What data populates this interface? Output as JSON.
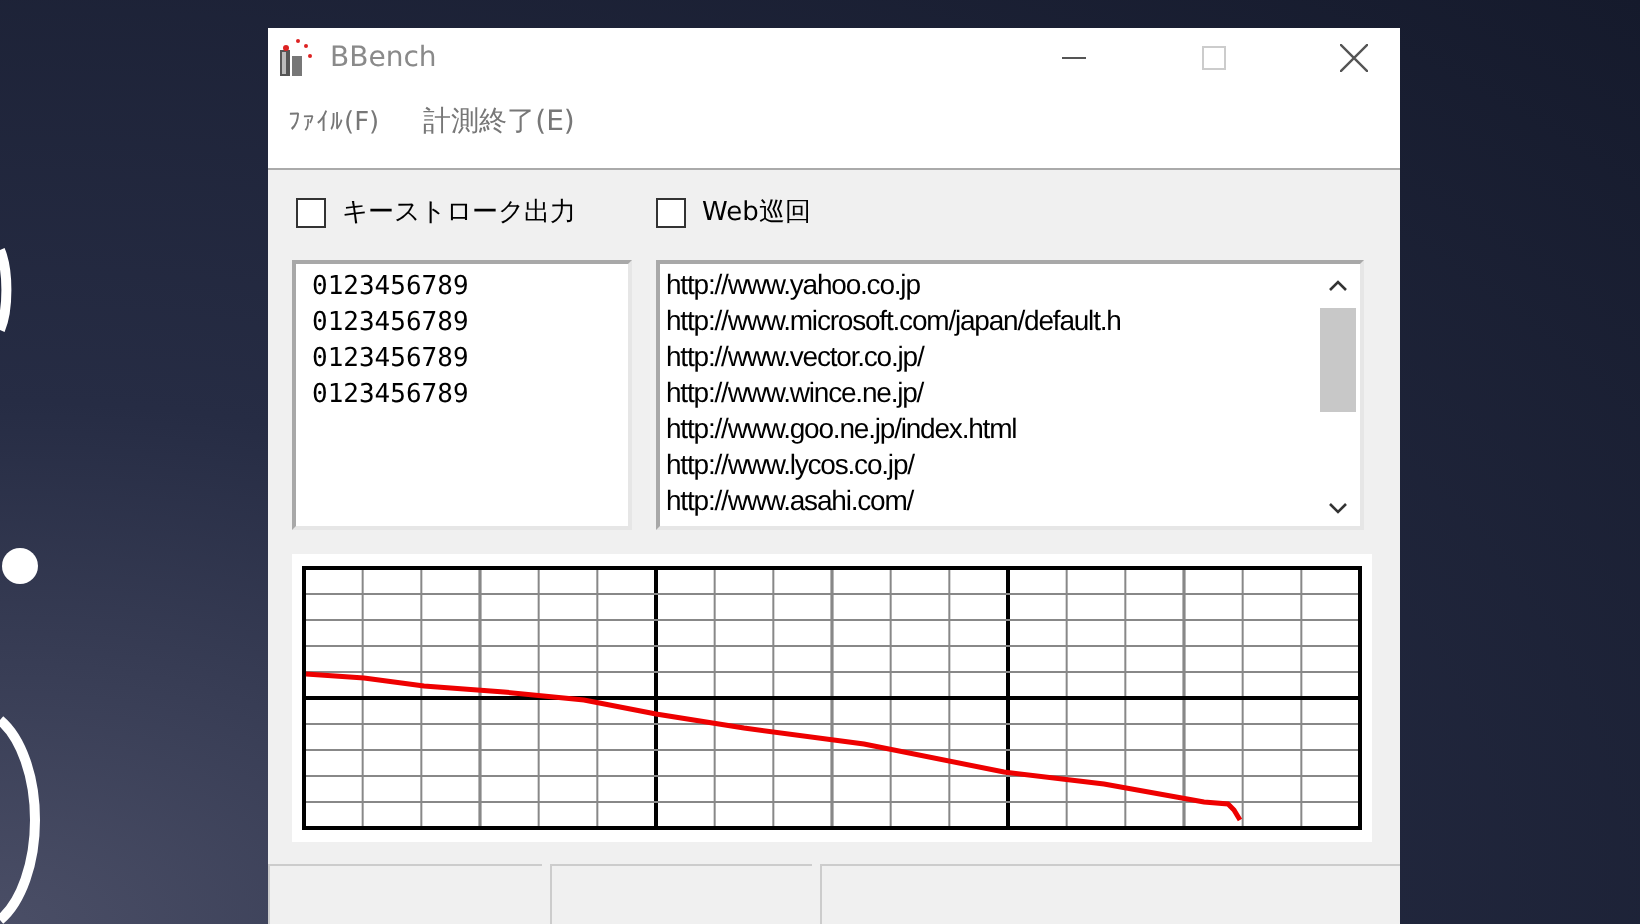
{
  "window": {
    "title": "BBench"
  },
  "menu": [
    {
      "label": "ﾌｧｲﾙ(F)"
    },
    {
      "label": "計測終了(E)"
    }
  ],
  "options": [
    {
      "label": "キーストローク出力",
      "checked": false
    },
    {
      "label": "Web巡回",
      "checked": false
    }
  ],
  "keystroke_list": {
    "lines": [
      "0123456789",
      "0123456789",
      "0123456789",
      "0123456789"
    ]
  },
  "url_list": {
    "lines": [
      "http://www.yahoo.co.jp",
      "http://www.microsoft.com/japan/default.h",
      "http://www.vector.co.jp/",
      "http://www.wince.ne.jp/",
      "http://www.goo.ne.jp/index.html",
      "http://www.lycos.co.jp/",
      "http://www.asahi.com/"
    ]
  }
}
